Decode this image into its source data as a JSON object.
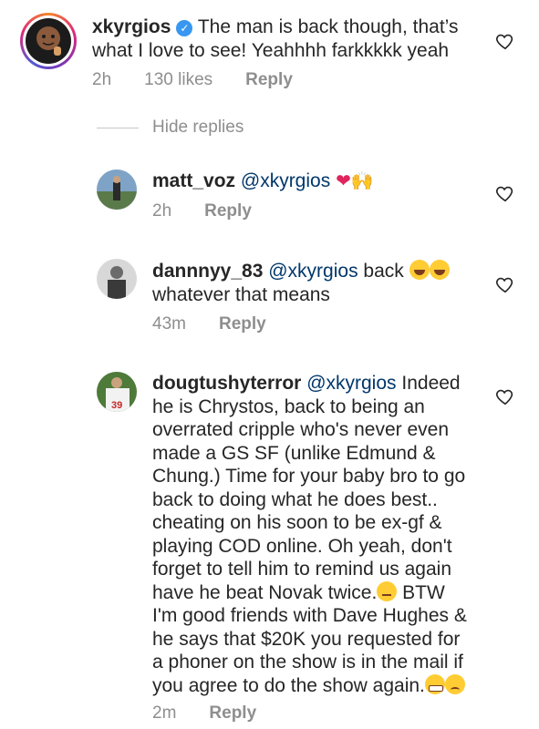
{
  "comments": [
    {
      "username": "xkyrgios",
      "verified": true,
      "text": "The man is back though, that’s what I love to see! Yeahhhh farkkkkk yeah",
      "time": "2h",
      "likes": "130 likes",
      "reply": "Reply"
    }
  ],
  "hide_replies": "Hide replies",
  "replies": [
    {
      "username": "matt_voz",
      "mention": "@xkyrgios",
      "text": "",
      "emojis": [
        "heart",
        "raising-hands"
      ],
      "time": "2h",
      "reply": "Reply"
    },
    {
      "username": "dannnyy_83",
      "mention": "@xkyrgios",
      "text_line1": "back",
      "text_line2": "whatever that means",
      "emojis": [
        "rolling-laughing",
        "rolling-laughing"
      ],
      "time": "43m",
      "reply": "Reply"
    },
    {
      "username": "dougtushyterror",
      "mention": "@xkyrgios",
      "line1": "Indeed",
      "lines": [
        "he is Chrystos, back to being an",
        "overrated cripple who's never even",
        "made a GS SF (unlike Edmund &",
        "Chung.) Time for your baby bro to go",
        "back to doing what he does best..",
        "cheating on his soon to be ex-gf &",
        "playing COD online. Oh yeah, don't",
        "forget to tell him to remind us again",
        "have he beat Novak twice.",
        "I'm good friends with Dave Hughes &",
        "he says that $20K you requested for",
        "a phoner on the show is in the mail if",
        "you agree to do the show again."
      ],
      "btw": "BTW",
      "time": "2m",
      "reply": "Reply"
    }
  ]
}
